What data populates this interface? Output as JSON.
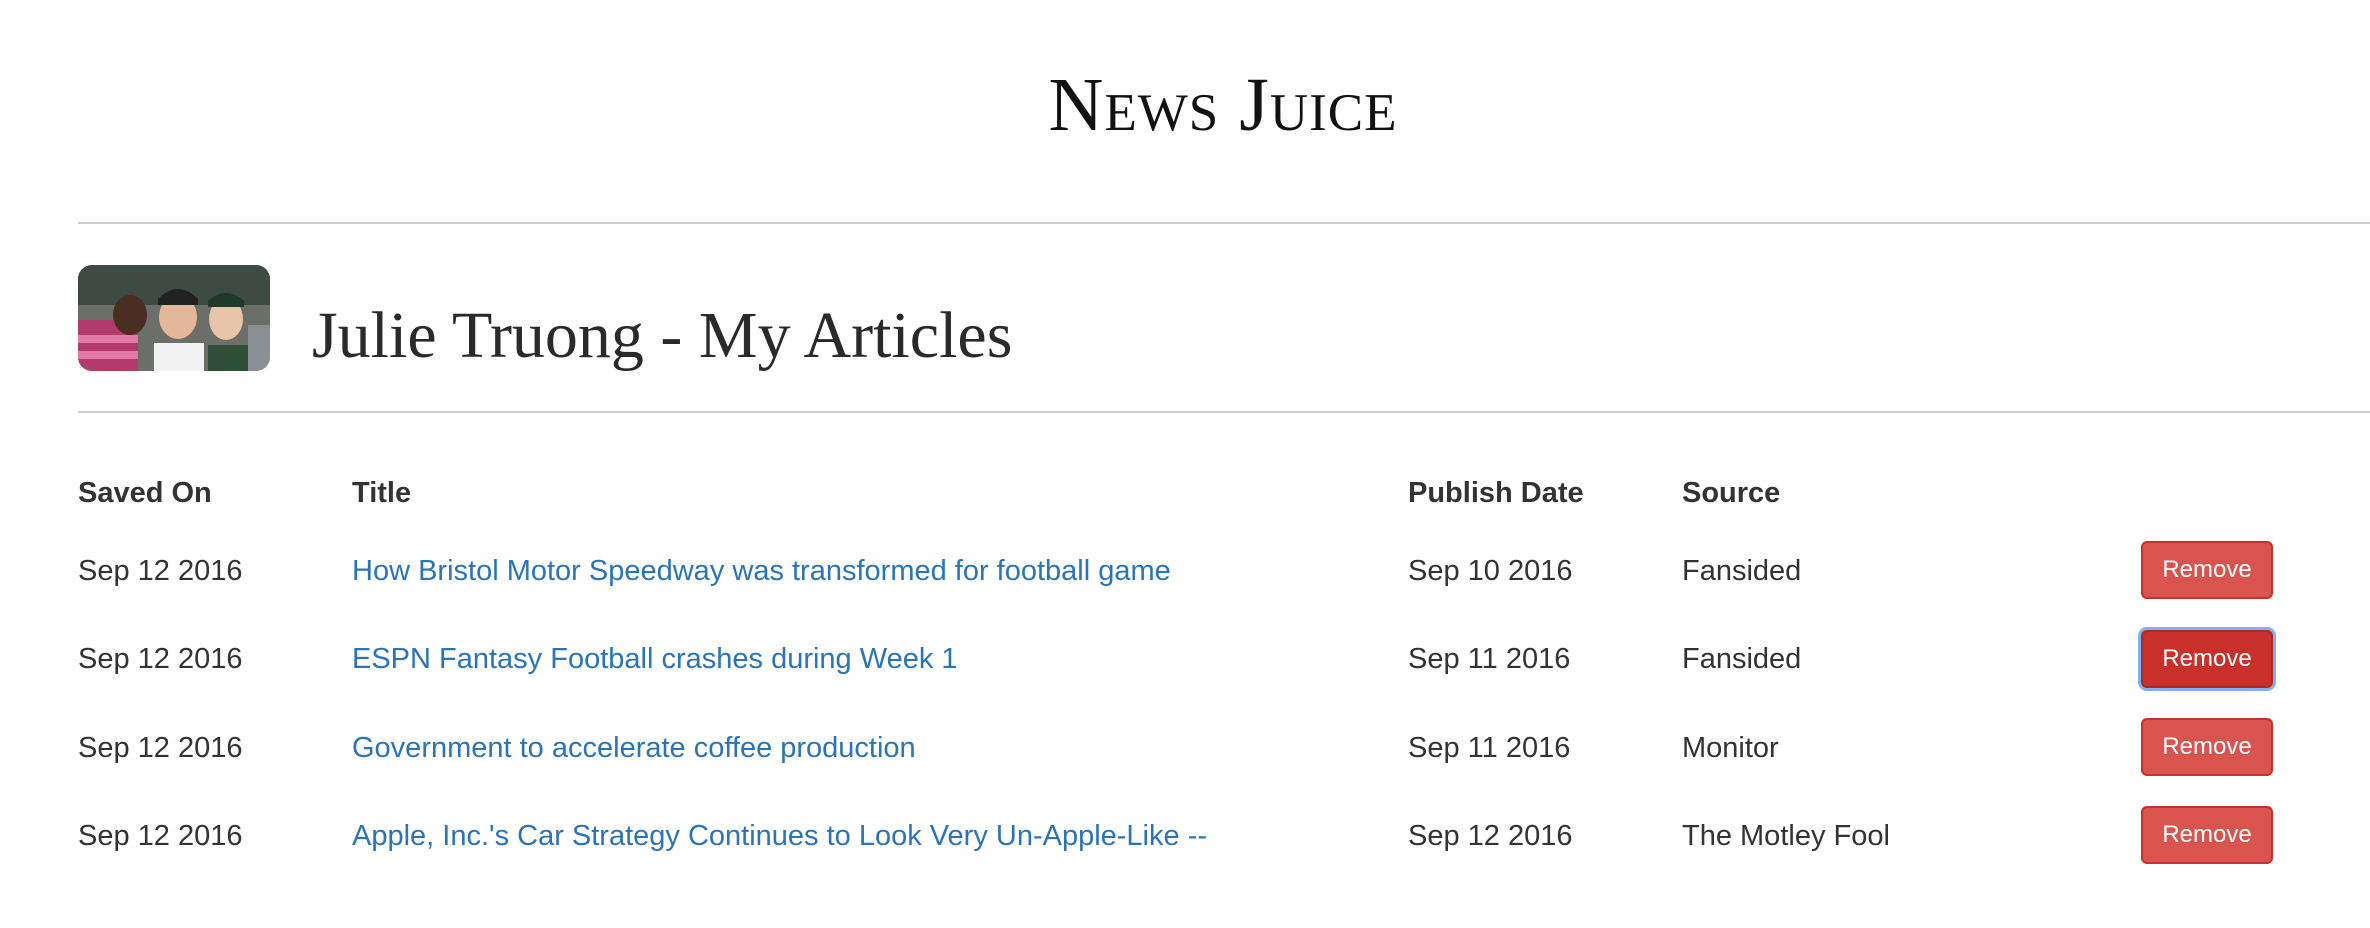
{
  "site": {
    "brand": "News Juice"
  },
  "profile": {
    "avatar_icon": "group-photo-avatar",
    "heading": "Julie Truong - My Articles"
  },
  "table": {
    "headers": {
      "saved_on": "Saved On",
      "title": "Title",
      "publish_date": "Publish Date",
      "source": "Source"
    },
    "rows": [
      {
        "saved_on": "Sep 12 2016",
        "title": "How Bristol Motor Speedway was transformed for football game",
        "publish_date": "Sep 10 2016",
        "source": "Fansided",
        "action": "Remove"
      },
      {
        "saved_on": "Sep 12 2016",
        "title": "ESPN Fantasy Football crashes during Week 1",
        "publish_date": "Sep 11 2016",
        "source": "Fansided",
        "action": "Remove"
      },
      {
        "saved_on": "Sep 12 2016",
        "title": "Government to accelerate coffee production",
        "publish_date": "Sep 11 2016",
        "source": "Monitor",
        "action": "Remove"
      },
      {
        "saved_on": "Sep 12 2016",
        "title": "Apple, Inc.'s Car Strategy Continues to Look Very Un-Apple-Like --",
        "publish_date": "Sep 12 2016",
        "source": "The Motley Fool",
        "action": "Remove"
      }
    ]
  },
  "colors": {
    "link": "#2a74b8",
    "danger": "#d9534f",
    "danger_active": "#c9302c",
    "focus_ring": "#7fb2f0"
  }
}
